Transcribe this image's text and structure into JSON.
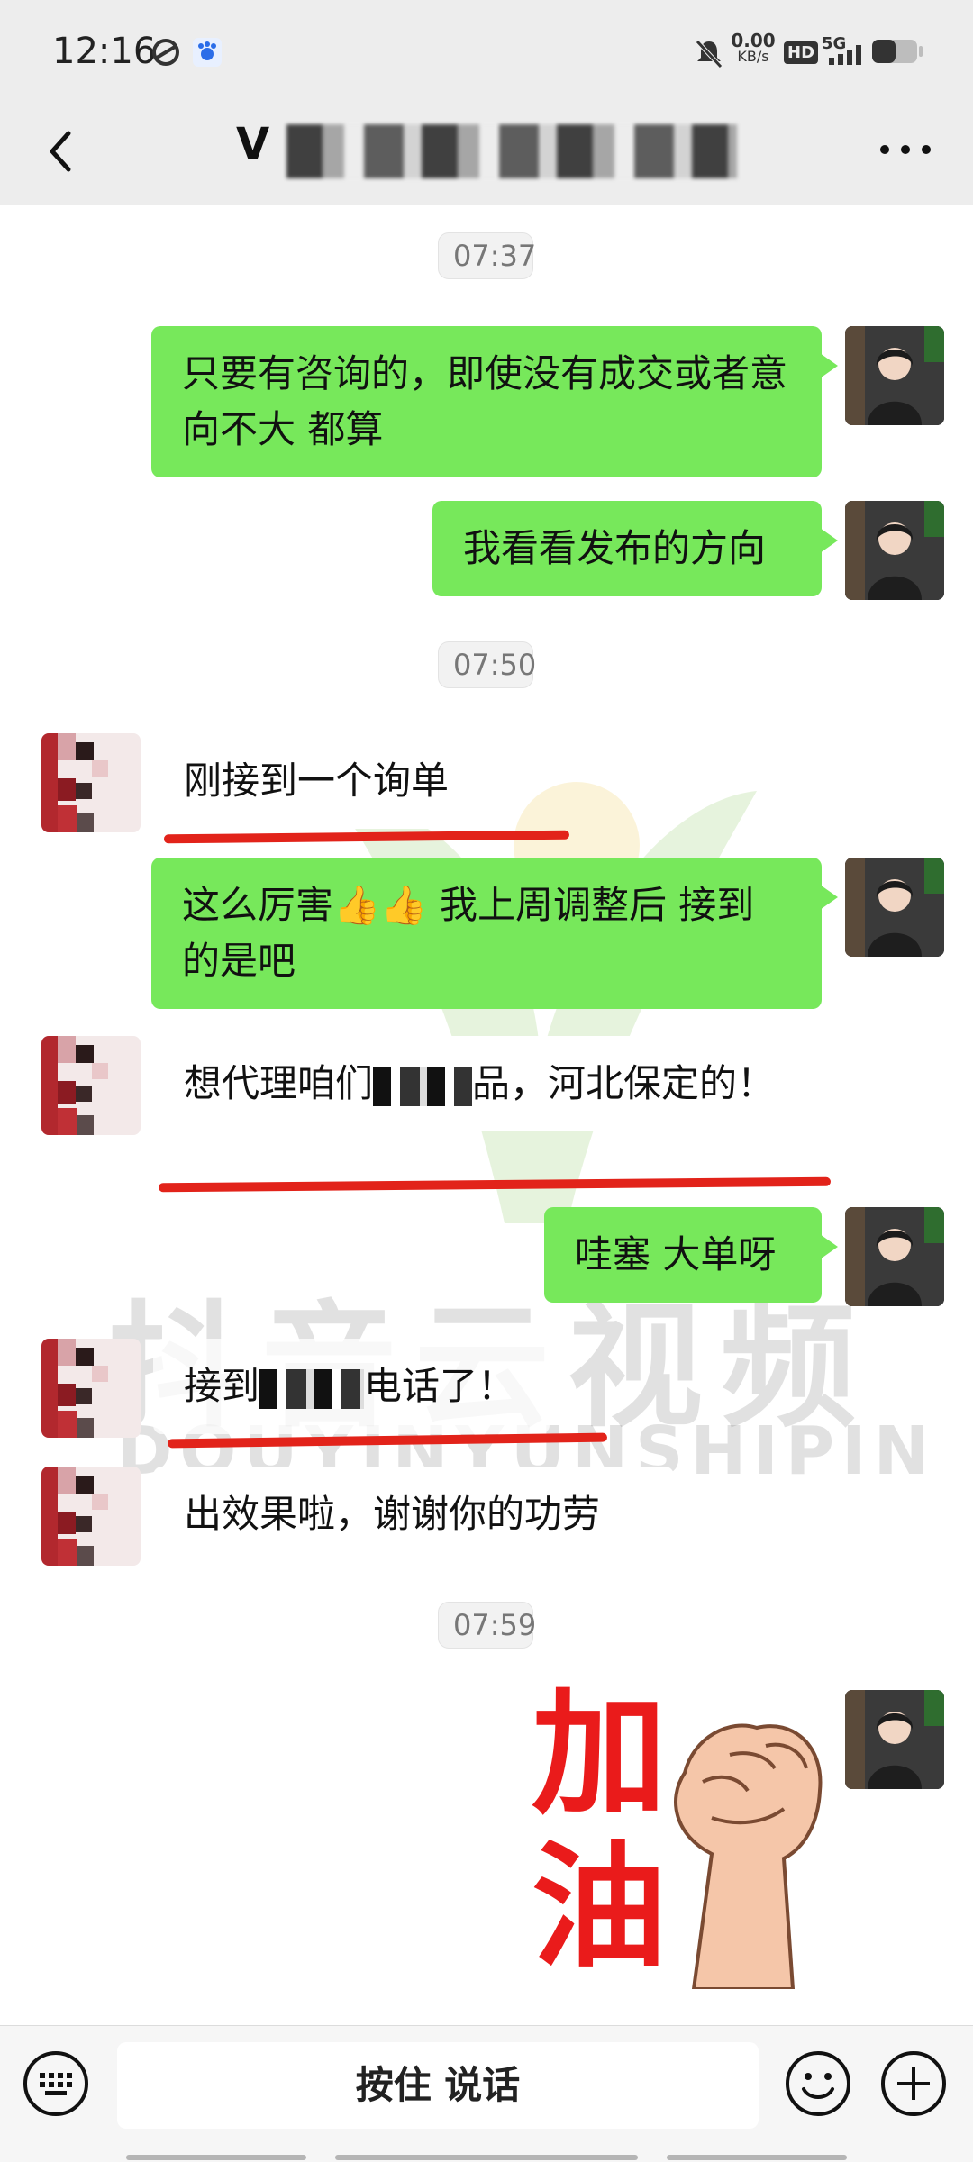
{
  "status_bar": {
    "time": "12:16",
    "net_speed_value": "0.00",
    "net_speed_unit": "KB/s",
    "hd": "HD",
    "network": "5G"
  },
  "header": {
    "title": "V"
  },
  "messages": {
    "t1": "07:37",
    "m1": "只要有咨询的，即使没有成交或者意向不大 都算",
    "m2": "我看看发布的方向",
    "t2": "07:50",
    "m3": "刚接到一个询单",
    "m4": "这么厉害👍👍 我上周调整后 接到的是吧",
    "m5_a": "想代理咱们",
    "m5_b": "品，河北保定的！",
    "m6": "哇塞 大单呀",
    "m7_a": "接到",
    "m7_b": "电话了！",
    "m8": "出效果啦，谢谢你的功劳",
    "t3": "07:59",
    "sticker_text_1": "加",
    "sticker_text_2": "油"
  },
  "watermark": {
    "main": "抖音云视频",
    "sub": "DOUYINYUNSHIPIN"
  },
  "input_bar": {
    "voice_label": "按住 说话"
  }
}
